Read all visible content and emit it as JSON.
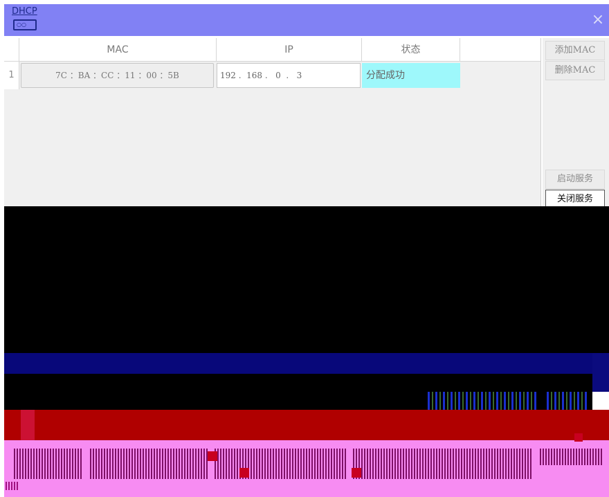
{
  "window": {
    "icon_text": "DHCP",
    "close_label": "×"
  },
  "table": {
    "headers": [
      "MAC",
      "IP",
      "状态"
    ],
    "rows": [
      {
        "index": "1",
        "mac": "7C ：BA ：CC ：11 ：00 ：5B",
        "ip": "192 .  168 .   0  .   3",
        "status": "分配成功"
      }
    ],
    "status_color": "#9ef8fb"
  },
  "buttons": {
    "add_mac": "添加MAC",
    "delete_mac": "删除MAC",
    "start_service": "启动服务",
    "stop_service": "关闭服务"
  },
  "colors": {
    "titlebar": "#8181f4",
    "panel": "#f0f0f0"
  }
}
